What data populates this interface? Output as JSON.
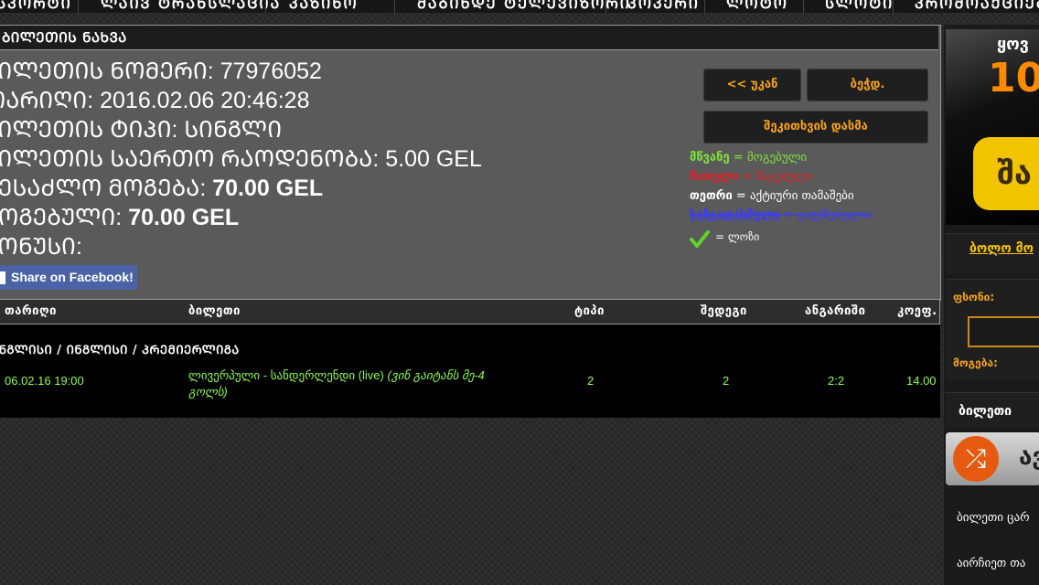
{
  "nav": [
    "ᲡᲞᲝᲠᲢᲘ",
    "ᲚᲐᲘᲕ ᲢᲠᲐᲜᲡᲚᲐᲪᲘᲐ",
    "ᲙᲐᲖᲘᲜᲝ",
    "ᲛᲐᲑᲘᲜᲓᲔ ᲢᲔᲚᲔᲕᲘᲖᲝᲠᲘ",
    "ᲞᲝᲙᲔᲠᲘ",
    "ᲚᲝᲢᲝ",
    "ᲡᲚᲝᲢᲘ",
    "ᲞᲠᲝᲛᲝᲐᲥᲪᲘᲔᲑᲘ"
  ],
  "panel": {
    "title": "ᲑᲘᲚᲔᲗᲘᲡ ᲜᲐᲮᲕᲐ",
    "ticket_number_label": "ᲑᲘᲚᲔᲗᲘᲡ ᲜᲝᲛᲔᲠᲘ:",
    "ticket_number": "77976052",
    "date_label": "ᲗᲐᲠᲘᲦᲘ:",
    "date": "2016.02.06 20:46:28",
    "type_label": "ᲑᲘᲚᲔᲗᲘᲡ ᲢᲘᲞᲘ:",
    "type": "ᲡᲘᲜᲒᲚᲘ",
    "total_label": "ᲑᲘᲚᲔᲗᲘᲡ ᲡᲐᲔᲠᲗᲝ ᲠᲐᲝᲓᲔᲜᲝᲑᲐ:",
    "total": "5.00 GEL",
    "possible_label": "ᲨᲔᲡᲐᲫᲚᲝ ᲛᲝᲒᲔᲑᲐ:",
    "possible": "70.00 GEL",
    "won_label": "ᲛᲝᲒᲔᲑᲣᲚᲘ:",
    "won": "70.00 GEL",
    "bonus_label": "ᲑᲝᲜᲣᲡᲘ:",
    "facebook": "Share on Facebook!"
  },
  "buttons": {
    "back": "<< უკან",
    "print": "ბეჭდ.",
    "check": "შეკითხვის დასმა"
  },
  "legend": {
    "green_word": "მწვანე",
    "green_text": " = მოგებული",
    "red_word": "წითელი",
    "red_text": " = წაგებული",
    "white_word": "თეთრი",
    "white_text": " = აქტიური თამაშები",
    "blue_word": "ხაზგადასმული",
    "blue_text": " = გაუქმებულია",
    "check_text": "= ლოზი"
  },
  "colors": {
    "green": "#7de33a",
    "red": "#e0202a",
    "blue": "#3a3aff",
    "orange": "#f6a21a"
  },
  "table": {
    "headers": [
      "თარიღი",
      "ბილეთი",
      "ტიპი",
      "შედეგი",
      "ანგარიში",
      "კოეფ."
    ],
    "league": "ᲘᲜᲒᲚᲘᲡᲘ / ᲘᲜᲒᲚᲘᲡᲘ / ᲞᲠᲔᲛᲘᲔᲠᲚᲘᲒᲐ",
    "row": {
      "date": "06.02.16 19:00",
      "match": "ლივერპული - სანდერლენდი (live)",
      "match_note": "(ვინ გაიტანს მე-4 გოლს)",
      "type": "2",
      "result": "2",
      "score": "2:2",
      "coef": "14.00"
    }
  },
  "sidebar": {
    "banner_top": "ყოვ",
    "banner_num": "10",
    "banner_mid": "შა",
    "last_label": "ბოლო მო",
    "stake_label": "ფსონი:",
    "win_label": "მოგება:",
    "ticket_head": "ბილეთი",
    "rand_text": "ავ",
    "link1": "ბილეთი ცარ",
    "link2": "აირჩიეთ თა"
  }
}
